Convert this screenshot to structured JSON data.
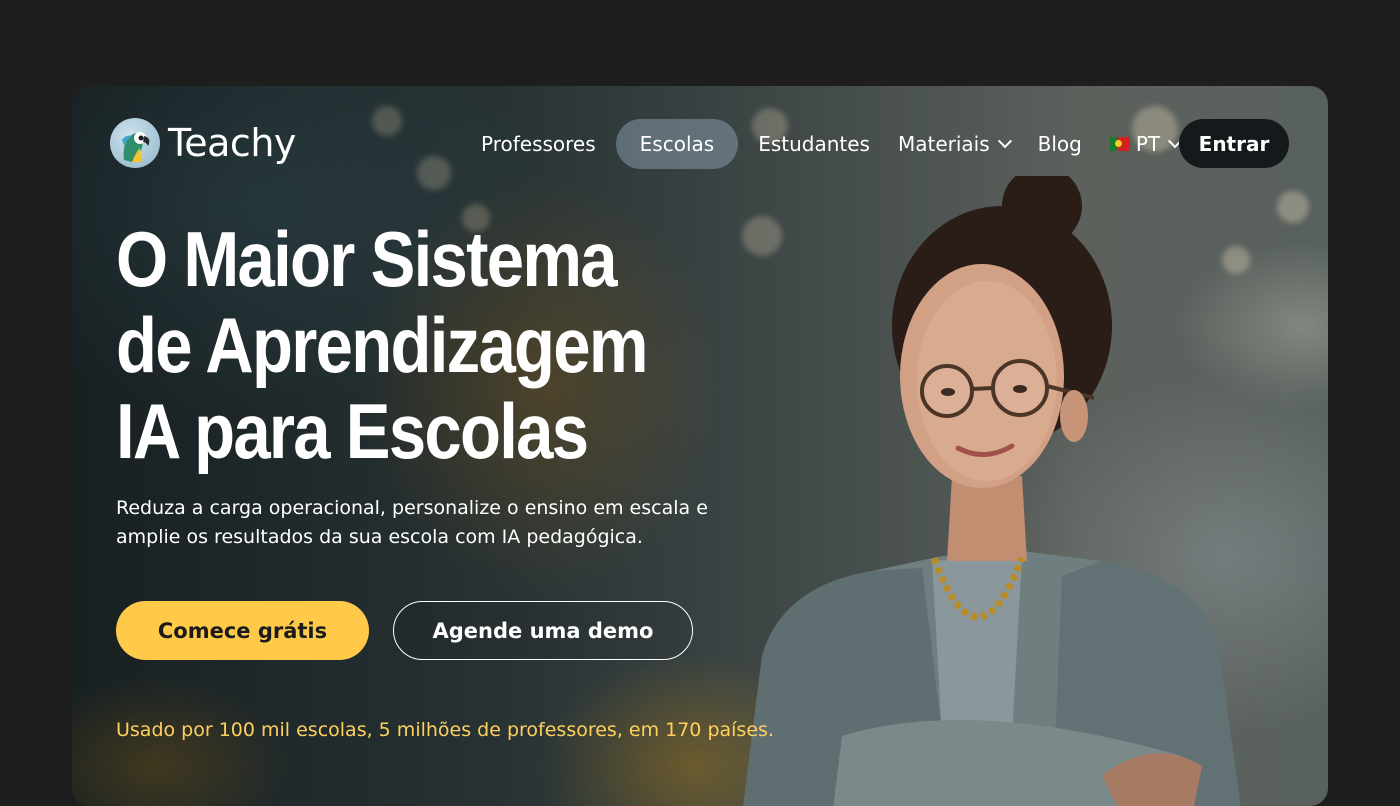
{
  "brand": {
    "name": "Teachy",
    "logo_icon": "parrot-logo-icon"
  },
  "nav": {
    "items": [
      {
        "label": "Professores"
      },
      {
        "label": "Escolas"
      },
      {
        "label": "Estudantes"
      },
      {
        "label": "Materiais"
      },
      {
        "label": "Blog"
      }
    ],
    "active_item": "Escolas",
    "language": "PT",
    "language_icon": "portugal-flag-icon",
    "login_label": "Entrar"
  },
  "hero": {
    "headline_lines": [
      "O Maior Sistema",
      "de Aprendizagem",
      "IA para Escolas"
    ],
    "subtitle_line1": "Reduza a carga operacional, personalize o ensino em escala  e",
    "subtitle_line2": "amplie os resultados da sua escola com IA pedagógica.",
    "primary_cta": "Comece grátis",
    "secondary_cta": "Agende uma demo",
    "stats": "Usado por 100 mil escolas, 5 milhões de professores, em 170 países."
  },
  "colors": {
    "page_background": "#1e1e1e",
    "accent_yellow": "#ffc94a",
    "stats_text": "#ffd15c",
    "login_button": "#141a1c"
  }
}
